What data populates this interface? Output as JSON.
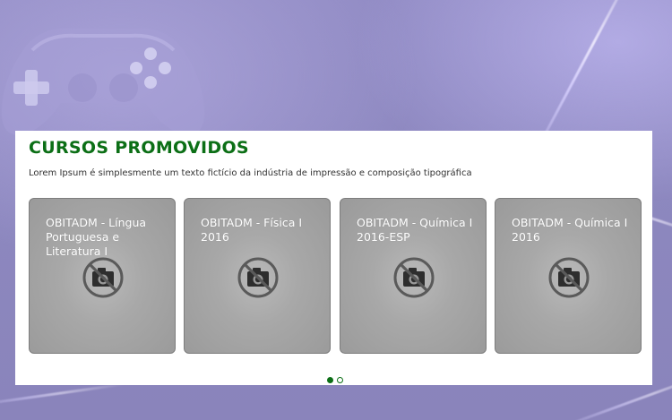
{
  "promoted_courses": {
    "title": "CURSOS PROMOVIDOS",
    "subtitle": "Lorem Ipsum é simplesmente um texto fictício da indústria de impressão e composição tipográfica",
    "accent_color": "#0c6f16",
    "courses": [
      {
        "title": "OBITADM - Língua Portuguesa e Literatura I",
        "image_icon": "no-image-camera-icon"
      },
      {
        "title": "OBITADM - Física I 2016",
        "image_icon": "no-image-camera-icon"
      },
      {
        "title": "OBITADM - Química I 2016-ESP",
        "image_icon": "no-image-camera-icon"
      },
      {
        "title": "OBITADM - Química I 2016",
        "image_icon": "no-image-camera-icon"
      }
    ],
    "pagination": {
      "pages": 2,
      "current_page": 1
    }
  },
  "background": {
    "icon": "gamepad-icon"
  }
}
